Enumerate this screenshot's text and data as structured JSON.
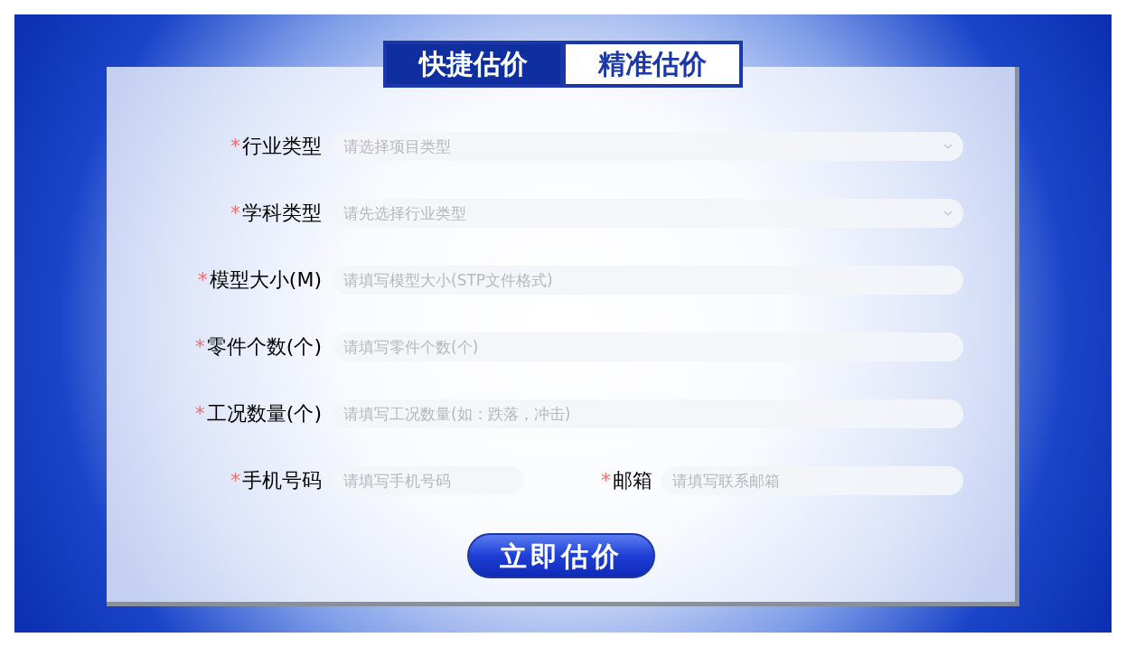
{
  "tabs": [
    {
      "label": "快捷估价",
      "selected": true
    },
    {
      "label": "精准估价",
      "selected": false
    }
  ],
  "fields": [
    {
      "kind": "select",
      "mark": "*",
      "label": "行业类型",
      "placeholder": "请选择项目类型"
    },
    {
      "kind": "select",
      "mark": "*",
      "label": "学科类型",
      "placeholder": "请先选择行业类型"
    },
    {
      "kind": "input",
      "mark": "*",
      "label": "模型大小(M)",
      "placeholder": "请填写模型大小(STP文件格式)"
    },
    {
      "kind": "input",
      "mark": "*",
      "label": "零件个数(个)",
      "placeholder": "请填写零件个数(个)"
    },
    {
      "kind": "input",
      "mark": "*",
      "label": "工况数量(个)",
      "placeholder": "请填写工况数量(如：跌落，冲击)"
    }
  ],
  "contact": [
    {
      "mark": "*",
      "label": "手机号码",
      "placeholder": "请填写手机号码"
    },
    {
      "mark": "*",
      "label": "邮箱",
      "placeholder": "请填写联系邮箱"
    }
  ],
  "submit": "立即估价"
}
